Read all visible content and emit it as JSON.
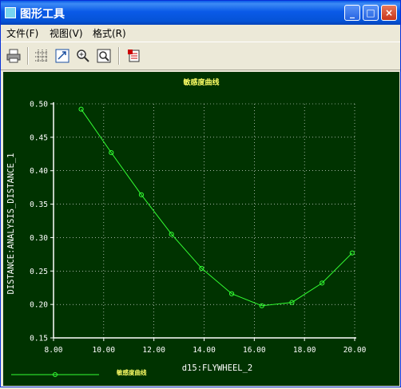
{
  "window": {
    "title": "图形工具",
    "controls": {
      "minimize": "_",
      "maximize": "□",
      "close": "×"
    }
  },
  "menu": [
    {
      "label": "文件(F)"
    },
    {
      "label": "视图(V)"
    },
    {
      "label": "格式(R)"
    }
  ],
  "toolbar": {
    "buttons": [
      "print-icon",
      "grid-icon",
      "refit-icon",
      "zoom-in-icon",
      "zoom-to-fit-icon",
      "export-icon"
    ]
  },
  "colors": {
    "plot_bg": "#003300",
    "axes": "#ffffff",
    "series": "#33ff33",
    "labels": "#ffff66"
  },
  "chart_data": {
    "type": "line",
    "title": "敏感度曲线",
    "xlabel": "d15:FLYWHEEL_2",
    "ylabel": "DISTANCE:ANALYSIS_DISTANCE_1",
    "xlim": [
      8.0,
      20.0
    ],
    "ylim": [
      0.15,
      0.5
    ],
    "x_ticks": [
      "8.00",
      "10.00",
      "12.00",
      "14.00",
      "16.00",
      "18.00",
      "20.00"
    ],
    "y_ticks": [
      "0.15",
      "0.20",
      "0.25",
      "0.30",
      "0.35",
      "0.40",
      "0.45",
      "0.50"
    ],
    "grid": true,
    "legend_position": "bottom-left",
    "series": [
      {
        "name": "敏感度曲线",
        "x": [
          9.1,
          10.3,
          11.5,
          12.7,
          13.9,
          15.1,
          16.3,
          17.5,
          18.7,
          19.9
        ],
        "y": [
          0.492,
          0.427,
          0.364,
          0.305,
          0.254,
          0.216,
          0.198,
          0.203,
          0.232,
          0.277
        ]
      }
    ]
  }
}
